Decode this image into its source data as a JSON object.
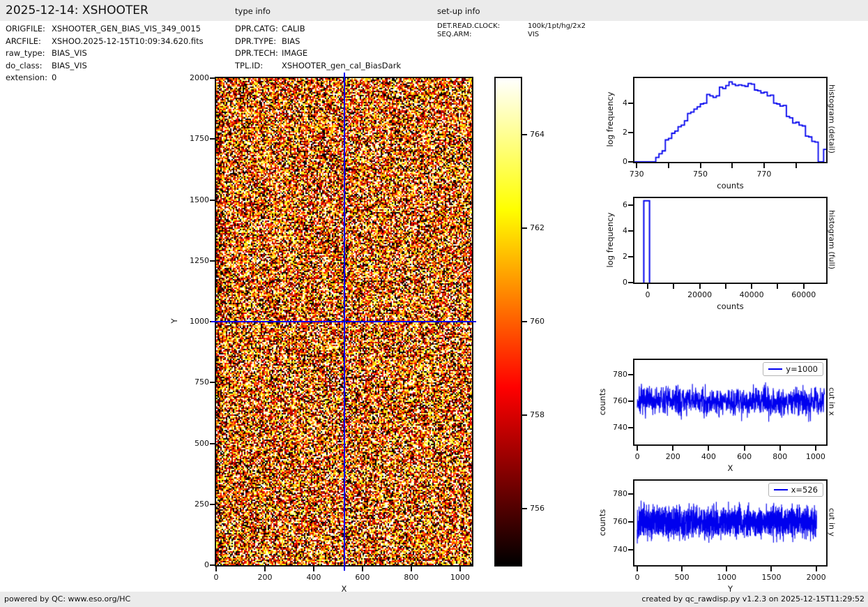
{
  "header": {
    "title": "2025-12-14: XSHOOTER",
    "type_info_label": "type info",
    "setup_info_label": "set-up info"
  },
  "file_info": {
    "rows": [
      {
        "label": "ORIGFILE:",
        "value": "XSHOOTER_GEN_BIAS_VIS_349_0015"
      },
      {
        "label": "ARCFILE:",
        "value": "XSHOO.2025-12-15T10:09:34.620.fits"
      },
      {
        "label": "raw_type:",
        "value": "BIAS_VIS"
      },
      {
        "label": "do_class:",
        "value": "BIAS_VIS"
      },
      {
        "label": "extension:",
        "value": "0"
      }
    ]
  },
  "type_info": {
    "rows": [
      {
        "label": "DPR.CATG:",
        "value": "CALIB"
      },
      {
        "label": "DPR.TYPE:",
        "value": "BIAS"
      },
      {
        "label": "DPR.TECH:",
        "value": "IMAGE"
      },
      {
        "label": "TPL.ID:",
        "value": "XSHOOTER_gen_cal_BiasDark"
      }
    ]
  },
  "setup_info": {
    "rows": [
      {
        "label": "DET.READ.CLOCK:",
        "value": "100k/1pt/hg/2x2"
      },
      {
        "label": "SEQ.ARM:",
        "value": "VIS"
      }
    ]
  },
  "footer": {
    "left": "powered by QC: www.eso.org/HC",
    "right": "created by qc_rawdisp.py v1.2.3 on 2025-12-15T11:29:52"
  },
  "colors": {
    "line_blue": "#0000ee",
    "header_bg": "#ebebeb",
    "spine": "#111111",
    "hot_stops": [
      "#000000",
      "#ff0000",
      "#ffff00",
      "#ffffff"
    ]
  },
  "chart_data": [
    {
      "id": "main-image",
      "type": "heatmap",
      "xlabel": "X",
      "ylabel": "Y",
      "xlim": [
        0,
        1049
      ],
      "ylim": [
        0,
        2000
      ],
      "xticks": [
        0,
        200,
        400,
        600,
        800,
        1000
      ],
      "yticks": [
        0,
        250,
        500,
        750,
        1000,
        1250,
        1500,
        1750,
        2000
      ],
      "colormap": "hot",
      "display_range": [
        754.8,
        765.2
      ],
      "pixel_mean": 760,
      "pixel_sigma": 4.4,
      "crosshair": {
        "x": 526,
        "y": 1000
      }
    },
    {
      "id": "colorbar",
      "type": "colorbar",
      "colormap": "hot",
      "vmin": 754.8,
      "vmax": 765.2,
      "ticks": [
        756,
        758,
        760,
        762,
        764
      ]
    },
    {
      "id": "hist-detail",
      "type": "bar",
      "xlabel": "counts",
      "ylabel": "log frequency",
      "right_label": "histogram (detail)",
      "xlim": [
        729.3,
        789.5
      ],
      "ylim": [
        0,
        5.71
      ],
      "xticks_labeled": [
        730,
        750,
        770
      ],
      "xticks_minor": [
        740,
        760,
        780
      ],
      "yticks": [
        0,
        2,
        4
      ],
      "bin_start": 735,
      "bin_width": 1,
      "log_frequency": [
        0,
        0.3,
        0.55,
        0.75,
        1.5,
        1.6,
        1.95,
        2.1,
        2.4,
        2.5,
        2.8,
        3.3,
        3.4,
        3.6,
        3.75,
        3.95,
        4.0,
        4.6,
        4.5,
        4.4,
        4.5,
        5.1,
        5.0,
        5.2,
        5.45,
        5.3,
        5.2,
        5.25,
        5.2,
        5.15,
        5.35,
        5.3,
        4.9,
        4.85,
        4.7,
        4.75,
        4.5,
        4.55,
        4.0,
        3.95,
        3.8,
        3.85,
        3.1,
        3.0,
        2.65,
        2.7,
        2.5,
        2.45,
        1.75,
        1.7,
        1.4,
        1.35
      ],
      "edge_bar": {
        "x0": 788.7,
        "x1": 789.5,
        "height": 0.85
      }
    },
    {
      "id": "hist-full",
      "type": "bar",
      "xlabel": "counts",
      "ylabel": "log frequency",
      "right_label": "histogram (full)",
      "xlim": [
        -5100,
        68650
      ],
      "ylim": [
        0,
        6.55
      ],
      "xticks_labeled": [
        0,
        20000,
        40000,
        60000
      ],
      "xticks_minor": [
        10000,
        30000,
        50000
      ],
      "yticks": [
        0,
        2,
        4,
        6
      ],
      "bars": [
        {
          "x0": -1500,
          "x1": 700,
          "height": 6.35
        }
      ]
    },
    {
      "id": "cut-x",
      "type": "line",
      "xlabel": "X",
      "ylabel": "counts",
      "right_label": "cut in x",
      "legend_label": "y=1000",
      "xlim": [
        -16,
        1059
      ],
      "ylim": [
        727.4,
        791
      ],
      "xticks": [
        0,
        200,
        400,
        600,
        800,
        1000
      ],
      "yticks": [
        740,
        760,
        780
      ],
      "series": {
        "x_start": 0,
        "x_end": 1049,
        "n": 1050,
        "mean": 760,
        "sigma": 5.5
      }
    },
    {
      "id": "cut-y",
      "type": "line",
      "xlabel": "Y",
      "ylabel": "counts",
      "right_label": "cut in y",
      "legend_label": "x=526",
      "xlim": [
        -31,
        2112
      ],
      "ylim": [
        729,
        789.5
      ],
      "xticks": [
        0,
        500,
        1000,
        1500,
        2000
      ],
      "yticks": [
        740,
        760,
        780
      ],
      "series": {
        "x_start": 0,
        "x_end": 2005,
        "n": 2006,
        "mean": 760,
        "sigma": 5.5
      }
    }
  ]
}
